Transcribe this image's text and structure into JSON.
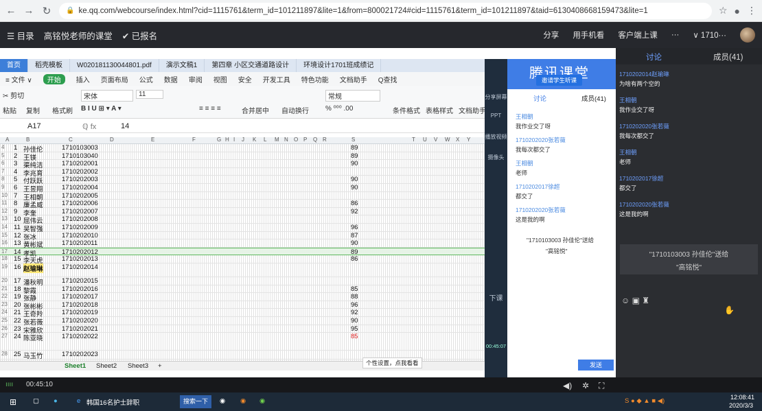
{
  "browser": {
    "url": "ke.qq.com/webcourse/index.html?cid=1115761&term_id=101211897&lite=1&from=800021724#cid=1115761&term_id=101211897&taid=6130408668159473&lite=1",
    "back_icon": "arrow-left-icon",
    "forward_icon": "arrow-right-icon",
    "reload_icon": "reload-icon"
  },
  "course_bar": {
    "menu_label": "☰ 目录",
    "course_title": "高铭悦老师的课堂",
    "enrolled_label": "✔ 已报名",
    "share_label": "分享",
    "mobile_label": "用手机看",
    "client_label": "客户端上课",
    "more_label": "···",
    "user_label": "∨ 1710···"
  },
  "wps": {
    "tabs": [
      "首页",
      "稻壳模板",
      "W020181130044801.pdf",
      "演示文稿1",
      "第四章 小区交通道路设计",
      "环境设计1701班成绩记"
    ],
    "menus": [
      "≡ 文件 ∨",
      "开始",
      "插入",
      "页面布局",
      "公式",
      "数据",
      "审阅",
      "视图",
      "安全",
      "开发工具",
      "特色功能",
      "文档助手",
      "Q查找"
    ],
    "ribbon": {
      "cut": "✂ 剪切",
      "paste": "粘贴",
      "copy": "复制",
      "format_painter": "格式刷",
      "font": "宋体",
      "size": "11",
      "merge": "合并居中",
      "wrap": "自动换行",
      "number_format": "常规",
      "conditional": "条件格式",
      "table_style": "表格样式",
      "doc_helper": "文档助手"
    },
    "cell_ref": "A17",
    "formula_value": "14",
    "columns": [
      "A",
      "B",
      "C",
      "D",
      "E",
      "F",
      "G",
      "H",
      "I",
      "J",
      "K",
      "L",
      "M",
      "N",
      "O",
      "P",
      "Q",
      "R",
      "S",
      "T",
      "U",
      "V",
      "W",
      "X",
      "Y"
    ],
    "rows": [
      {
        "r": "4",
        "n": "1",
        "name": "孙佳伦",
        "id": "1710103003",
        "score": "89"
      },
      {
        "r": "5",
        "n": "2",
        "name": "王镁",
        "id": "1710103040",
        "score": "89"
      },
      {
        "r": "6",
        "n": "3",
        "name": "渠纯洁",
        "id": "1710202001",
        "score": "90"
      },
      {
        "r": "7",
        "n": "4",
        "name": "李兆育",
        "id": "1710202002",
        "score": ""
      },
      {
        "r": "8",
        "n": "5",
        "name": "付跃跃",
        "id": "1710202003",
        "score": "90"
      },
      {
        "r": "9",
        "n": "6",
        "name": "王昱翔",
        "id": "1710202004",
        "score": "90"
      },
      {
        "r": "10",
        "n": "7",
        "name": "王相朝",
        "id": "1710202005",
        "score": ""
      },
      {
        "r": "11",
        "n": "8",
        "name": "廉孟威",
        "id": "1710202006",
        "score": "86"
      },
      {
        "r": "12",
        "n": "9",
        "name": "李奎",
        "id": "1710202007",
        "score": "92"
      },
      {
        "r": "13",
        "n": "10",
        "name": "屈伟云",
        "id": "1710202008",
        "score": ""
      },
      {
        "r": "14",
        "n": "11",
        "name": "吴智强",
        "id": "1710202009",
        "score": "96"
      },
      {
        "r": "15",
        "n": "12",
        "name": "张冰",
        "id": "1710202010",
        "score": "87"
      },
      {
        "r": "16",
        "n": "13",
        "name": "黄彬斌",
        "id": "1710202011",
        "score": "90"
      },
      {
        "r": "17",
        "n": "14",
        "name": "孝凯",
        "id": "1710202012",
        "score": "89"
      },
      {
        "r": "18",
        "n": "15",
        "name": "李天虎",
        "id": "1710202013",
        "score": "86"
      },
      {
        "r": "19",
        "n": "16",
        "name": "赵瑜琳",
        "id": "1710202014",
        "score": ""
      },
      {
        "r": "20",
        "n": "17",
        "name": "潘秋明",
        "id": "1710202015",
        "score": ""
      },
      {
        "r": "21",
        "n": "18",
        "name": "黎霞",
        "id": "1710202016",
        "score": "85"
      },
      {
        "r": "22",
        "n": "19",
        "name": "张静",
        "id": "1710202017",
        "score": "88"
      },
      {
        "r": "23",
        "n": "20",
        "name": "张彬彬",
        "id": "1710202018",
        "score": "96"
      },
      {
        "r": "24",
        "n": "21",
        "name": "王奇羚",
        "id": "1710202019",
        "score": "92"
      },
      {
        "r": "25",
        "n": "22",
        "name": "张若薇",
        "id": "1710202020",
        "score": "90"
      },
      {
        "r": "26",
        "n": "23",
        "name": "宋雅欣",
        "id": "1710202021",
        "score": "95"
      },
      {
        "r": "27",
        "n": "24",
        "name": "陈亚晓",
        "id": "1710202022",
        "score": "85"
      },
      {
        "r": "28",
        "n": "25",
        "name": "马玉竹",
        "id": "1710202023",
        "score": ""
      }
    ],
    "sheets": [
      "Sheet1",
      "Sheet2",
      "Sheet3",
      "+"
    ],
    "tooltip": "个性设置，点我看看"
  },
  "tencent": {
    "brand": "腾讯课堂",
    "upgrade": "邀请学生听课",
    "tab_discuss": "讨论",
    "tab_members": "成员(41)",
    "sidebar": [
      "分享屏幕",
      "PPT",
      "播放视频",
      "摄像头",
      "下课"
    ],
    "timer": "00:45:07",
    "messages": [
      {
        "user": "王相朝",
        "text": "我作业交了呀"
      },
      {
        "user": "1710202020张若薇",
        "text": "我每次都交了"
      },
      {
        "user": "王相朝",
        "text": "老师"
      },
      {
        "user": "1710202017徐超",
        "text": "都交了"
      },
      {
        "user": "1710202020张若薇",
        "text": "这是我的啊"
      }
    ],
    "gift_line1": "\"1710103003 孙佳伦\"送给",
    "gift_line2": "\"高铭悦\"",
    "send": "发送"
  },
  "side": {
    "tab_discuss": "讨论",
    "tab_members": "成员(41)",
    "messages": [
      {
        "user": "1710202014赵瑜琳",
        "text": "为啥有两个空的"
      },
      {
        "user": "王相朝",
        "text": "我作业交了呀"
      },
      {
        "user": "1710202020张若薇",
        "text": "我每次都交了"
      },
      {
        "user": "王相朝",
        "text": "老师"
      },
      {
        "user": "1710202017徐超",
        "text": "都交了"
      },
      {
        "user": "1710202020张若薇",
        "text": "这是我的啊"
      }
    ],
    "gift_line1": "\"1710103003 孙佳伦\"送给",
    "gift_line2": "\"高铭悦\""
  },
  "player": {
    "time": "00:45:10"
  },
  "taskbar": {
    "app_label": "韩国16名护士辞职",
    "search": "搜索一下",
    "time": "12:08:41",
    "date": "2020/3/3"
  }
}
